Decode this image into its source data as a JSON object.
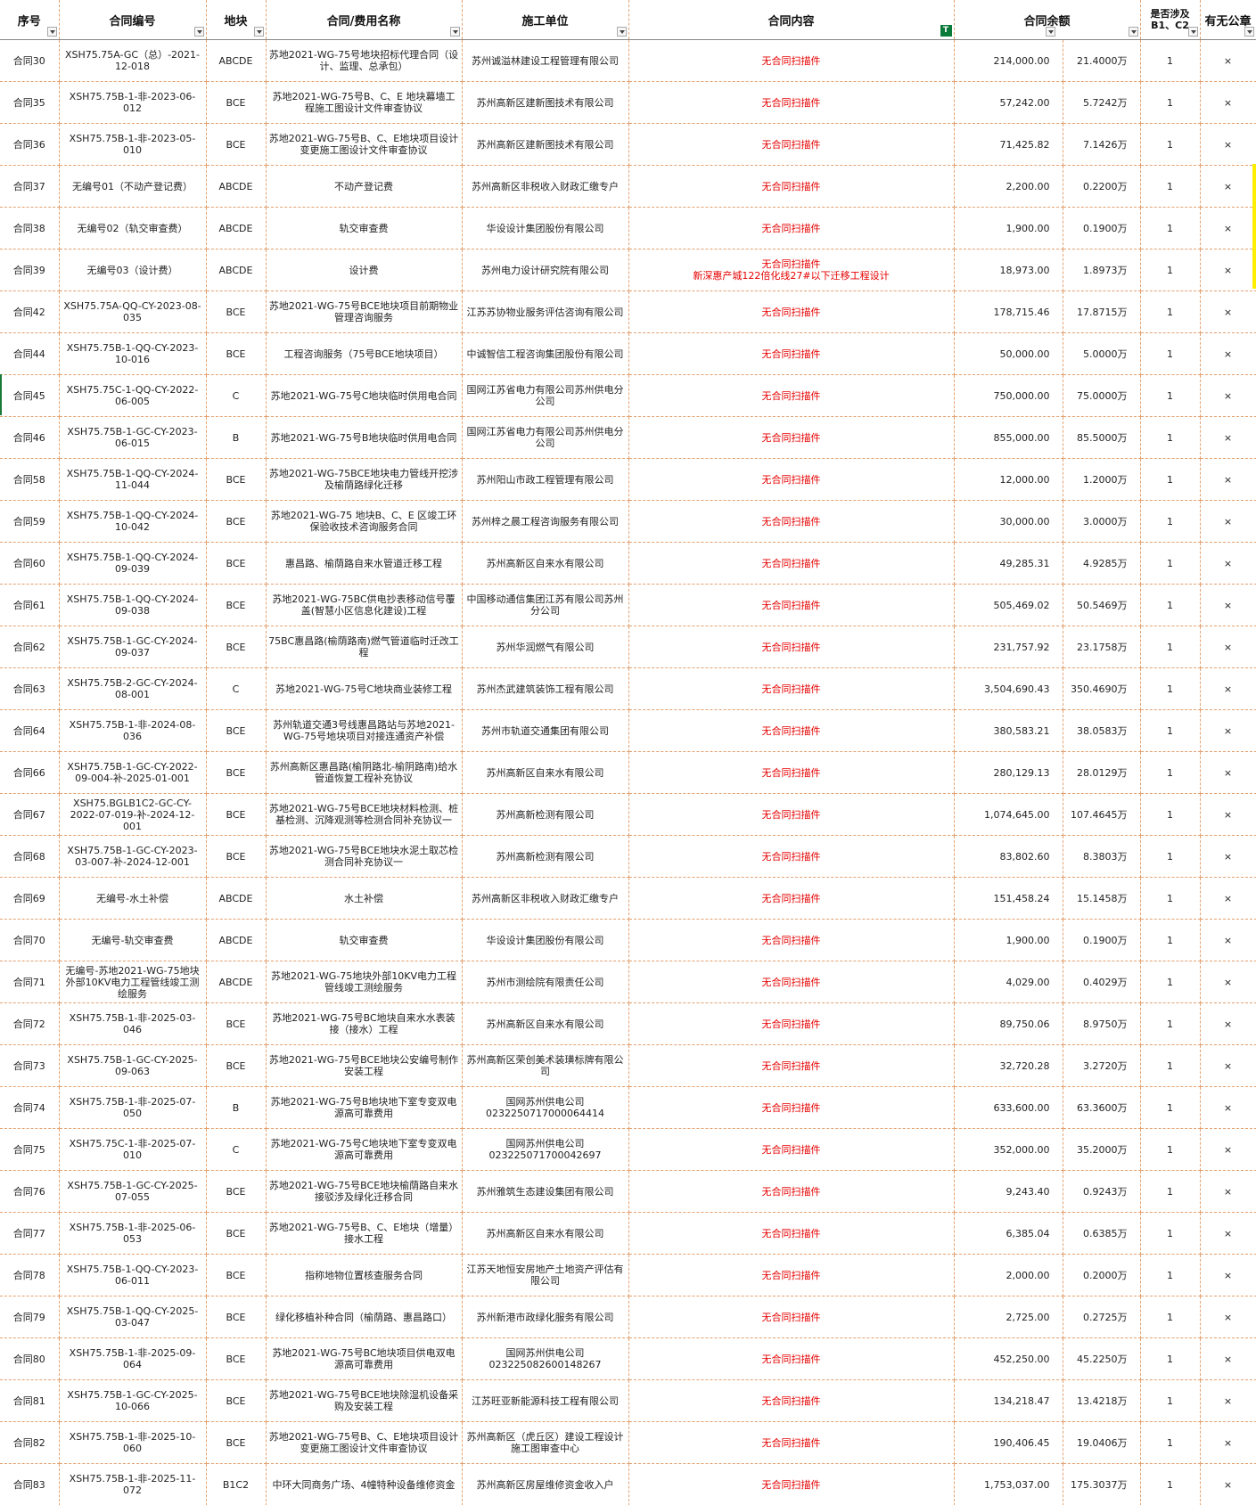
{
  "headers": {
    "seq": "序号",
    "code": "合同编号",
    "plot": "地块",
    "name": "合同/费用名称",
    "unit": "施工单位",
    "content": "合同内容",
    "amount": "合同余额",
    "involve_1": "是否涉及",
    "involve_2": "B1、C2",
    "stamp": "有无公章"
  },
  "icons": {
    "dropdown": "chevron-down-icon",
    "filter_active": "filter-icon"
  },
  "colors": {
    "red_text": "#e60000",
    "grid_border": "#e3a170",
    "filter_green": "#0a7a3a",
    "highlight_yellow": "#ffee00"
  },
  "rows": [
    {
      "seq": "合同30",
      "code": "XSH75.75A-GC（总）-2021-12-018",
      "plot": "ABCDE",
      "name": "苏地2021-WG-75号地块招标代理合同（设计、监理、总承包）",
      "unit": "苏州诚溢林建设工程管理有限公司",
      "content": "无合同扫描件",
      "content2": "",
      "amount": "214,000.00",
      "wan": "21.4000万",
      "involve": "1",
      "stamp": "×"
    },
    {
      "seq": "合同35",
      "code": "XSH75.75B-1-非-2023-06-012",
      "plot": "BCE",
      "name": "苏地2021-WG-75号B、C、E 地块幕墙工程施工图设计文件审查协议",
      "unit": "苏州高新区建新图技术有限公司",
      "content": "无合同扫描件",
      "content2": "",
      "amount": "57,242.00",
      "wan": "5.7242万",
      "involve": "1",
      "stamp": "×"
    },
    {
      "seq": "合同36",
      "code": "XSH75.75B-1-非-2023-05-010",
      "plot": "BCE",
      "name": "苏地2021-WG-75号B、C、E地块项目设计变更施工图设计文件审查协议",
      "unit": "苏州高新区建新图技术有限公司",
      "content": "无合同扫描件",
      "content2": "",
      "amount": "71,425.82",
      "wan": "7.1426万",
      "involve": "1",
      "stamp": "×"
    },
    {
      "seq": "合同37",
      "code": "无编号01（不动产登记费）",
      "plot": "ABCDE",
      "name": "不动产登记费",
      "unit": "苏州高新区非税收入财政汇缴专户",
      "content": "无合同扫描件",
      "content2": "",
      "amount": "2,200.00",
      "wan": "0.2200万",
      "involve": "1",
      "stamp": "×"
    },
    {
      "seq": "合同38",
      "code": "无编号02（轨交审查费）",
      "plot": "ABCDE",
      "name": "轨交审查费",
      "unit": "华设设计集团股份有限公司",
      "content": "无合同扫描件",
      "content2": "",
      "amount": "1,900.00",
      "wan": "0.1900万",
      "involve": "1",
      "stamp": "×"
    },
    {
      "seq": "合同39",
      "code": "无编号03（设计费）",
      "plot": "ABCDE",
      "name": "设计费",
      "unit": "苏州电力设计研究院有限公司",
      "content": "无合同扫描件",
      "content2": "新深惠产城122倍化线27#以下迁移工程设计",
      "amount": "18,973.00",
      "wan": "1.8973万",
      "involve": "1",
      "stamp": "×"
    },
    {
      "seq": "合同42",
      "code": "XSH75.75A-QQ-CY-2023-08-035",
      "plot": "BCE",
      "name": "苏地2021-WG-75号BCE地块项目前期物业管理咨询服务",
      "unit": "江苏苏协物业服务评估咨询有限公司",
      "content": "无合同扫描件",
      "content2": "",
      "amount": "178,715.46",
      "wan": "17.8715万",
      "involve": "1",
      "stamp": "×"
    },
    {
      "seq": "合同44",
      "code": "XSH75.75B-1-QQ-CY-2023-10-016",
      "plot": "BCE",
      "name": "工程咨询服务（75号BCE地块项目）",
      "unit": "中诚智信工程咨询集团股份有限公司",
      "content": "无合同扫描件",
      "content2": "",
      "amount": "50,000.00",
      "wan": "5.0000万",
      "involve": "1",
      "stamp": "×"
    },
    {
      "seq": "合同45",
      "code": "XSH75.75C-1-QQ-CY-2022-06-005",
      "plot": "C",
      "name": "苏地2021-WG-75号C地块临时供用电合同",
      "unit": "国网江苏省电力有限公司苏州供电分公司",
      "content": "无合同扫描件",
      "content2": "",
      "amount": "750,000.00",
      "wan": "75.0000万",
      "involve": "1",
      "stamp": "×"
    },
    {
      "seq": "合同46",
      "code": "XSH75.75B-1-GC-CY-2023-06-015",
      "plot": "B",
      "name": "苏地2021-WG-75号B地块临时供用电合同",
      "unit": "国网江苏省电力有限公司苏州供电分公司",
      "content": "无合同扫描件",
      "content2": "",
      "amount": "855,000.00",
      "wan": "85.5000万",
      "involve": "1",
      "stamp": "×"
    },
    {
      "seq": "合同58",
      "code": "XSH75.75B-1-QQ-CY-2024-11-044",
      "plot": "BCE",
      "name": "苏地2021-WG-75BCE地块电力管线开挖涉及榆荫路绿化迁移",
      "unit": "苏州阳山市政工程管理有限公司",
      "content": "无合同扫描件",
      "content2": "",
      "amount": "12,000.00",
      "wan": "1.2000万",
      "involve": "1",
      "stamp": "×"
    },
    {
      "seq": "合同59",
      "code": "XSH75.75B-1-QQ-CY-2024-10-042",
      "plot": "BCE",
      "name": "苏地2021-WG-75 地块B、C、E 区竣工环保验收技术咨询服务合同",
      "unit": "苏州梓之晨工程咨询服务有限公司",
      "content": "无合同扫描件",
      "content2": "",
      "amount": "30,000.00",
      "wan": "3.0000万",
      "involve": "1",
      "stamp": "×"
    },
    {
      "seq": "合同60",
      "code": "XSH75.75B-1-QQ-CY-2024-09-039",
      "plot": "BCE",
      "name": "惠昌路、榆荫路自来水管道迁移工程",
      "unit": "苏州高新区自来水有限公司",
      "content": "无合同扫描件",
      "content2": "",
      "amount": "49,285.31",
      "wan": "4.9285万",
      "involve": "1",
      "stamp": "×"
    },
    {
      "seq": "合同61",
      "code": "XSH75.75B-1-QQ-CY-2024-09-038",
      "plot": "BCE",
      "name": "苏地2021-WG-75BC供电抄表移动信号覆盖(智慧小区信息化建设)工程",
      "unit": "中国移动通信集团江苏有限公司苏州分公司",
      "content": "无合同扫描件",
      "content2": "",
      "amount": "505,469.02",
      "wan": "50.5469万",
      "involve": "1",
      "stamp": "×"
    },
    {
      "seq": "合同62",
      "code": "XSH75.75B-1-GC-CY-2024-09-037",
      "plot": "BCE",
      "name": "75BC惠昌路(榆荫路南)燃气管道临时迁改工程",
      "unit": "苏州华润燃气有限公司",
      "content": "无合同扫描件",
      "content2": "",
      "amount": "231,757.92",
      "wan": "23.1758万",
      "involve": "1",
      "stamp": "×"
    },
    {
      "seq": "合同63",
      "code": "XSH75.75B-2-GC-CY-2024-08-001",
      "plot": "C",
      "name": "苏地2021-WG-75号C地块商业装修工程",
      "unit": "苏州杰武建筑装饰工程有限公司",
      "content": "无合同扫描件",
      "content2": "",
      "amount": "3,504,690.43",
      "wan": "350.4690万",
      "involve": "1",
      "stamp": "×"
    },
    {
      "seq": "合同64",
      "code": "XSH75.75B-1-非-2024-08-036",
      "plot": "BCE",
      "name": "苏州轨道交通3号线惠昌路站与苏地2021-WG-75号地块项目对接连通资产补偿",
      "unit": "苏州市轨道交通集团有限公司",
      "content": "无合同扫描件",
      "content2": "",
      "amount": "380,583.21",
      "wan": "38.0583万",
      "involve": "1",
      "stamp": "×"
    },
    {
      "seq": "合同66",
      "code": "XSH75.75B-1-GC-CY-2022-09-004-补-2025-01-001",
      "plot": "BCE",
      "name": "苏州高新区惠昌路(榆阴路北-榆阴路南)给水管道恢复工程补充协议",
      "unit": "苏州高新区自来水有限公司",
      "content": "无合同扫描件",
      "content2": "",
      "amount": "280,129.13",
      "wan": "28.0129万",
      "involve": "1",
      "stamp": "×"
    },
    {
      "seq": "合同67",
      "code": "XSH75.BGLB1C2-GC-CY-2022-07-019-补-2024-12-001",
      "plot": "BCE",
      "name": "苏地2021-WG-75号BCE地块材料检测、桩基检测、沉降观测等检测合同补充协议一",
      "unit": "苏州高新检测有限公司",
      "content": "无合同扫描件",
      "content2": "",
      "amount": "1,074,645.00",
      "wan": "107.4645万",
      "involve": "1",
      "stamp": "×"
    },
    {
      "seq": "合同68",
      "code": "XSH75.75B-1-GC-CY-2023-03-007-补-2024-12-001",
      "plot": "BCE",
      "name": "苏地2021-WG-75号BCE地块水泥土取芯检测合同补充协议一",
      "unit": "苏州高新检测有限公司",
      "content": "无合同扫描件",
      "content2": "",
      "amount": "83,802.60",
      "wan": "8.3803万",
      "involve": "1",
      "stamp": "×"
    },
    {
      "seq": "合同69",
      "code": "无编号-水土补偿",
      "plot": "ABCDE",
      "name": "水土补偿",
      "unit": "苏州高新区非税收入财政汇缴专户",
      "content": "无合同扫描件",
      "content2": "",
      "amount": "151,458.24",
      "wan": "15.1458万",
      "involve": "1",
      "stamp": "×"
    },
    {
      "seq": "合同70",
      "code": "无编号-轨交审查费",
      "plot": "ABCDE",
      "name": "轨交审查费",
      "unit": "华设设计集团股份有限公司",
      "content": "无合同扫描件",
      "content2": "",
      "amount": "1,900.00",
      "wan": "0.1900万",
      "involve": "1",
      "stamp": "×"
    },
    {
      "seq": "合同71",
      "code": "无编号-苏地2021-WG-75地块外部10KV电力工程管线竣工测绘服务",
      "plot": "ABCDE",
      "name": "苏地2021-WG-75地块外部10KV电力工程管线竣工测绘服务",
      "unit": "苏州市测绘院有限责任公司",
      "content": "无合同扫描件",
      "content2": "",
      "amount": "4,029.00",
      "wan": "0.4029万",
      "involve": "1",
      "stamp": "×"
    },
    {
      "seq": "合同72",
      "code": "XSH75.75B-1-非-2025-03-046",
      "plot": "BCE",
      "name": "苏地2021-WG-75号BC地块自来水水表装接（接水）工程",
      "unit": "苏州高新区自来水有限公司",
      "content": "无合同扫描件",
      "content2": "",
      "amount": "89,750.06",
      "wan": "8.9750万",
      "involve": "1",
      "stamp": "×"
    },
    {
      "seq": "合同73",
      "code": "XSH75.75B-1-GC-CY-2025-09-063",
      "plot": "BCE",
      "name": "苏地2021-WG-75号BCE地块公安编号制作安装工程",
      "unit": "苏州高新区荣创美术装璜标牌有限公司",
      "content": "无合同扫描件",
      "content2": "",
      "amount": "32,720.28",
      "wan": "3.2720万",
      "involve": "1",
      "stamp": "×"
    },
    {
      "seq": "合同74",
      "code": "XSH75.75B-1-非-2025-07-050",
      "plot": "B",
      "name": "苏地2021-WG-75号B地块地下室专变双电源高可靠费用",
      "unit": "国网苏州供电公司 0232250717000064414",
      "content": "无合同扫描件",
      "content2": "",
      "amount": "633,600.00",
      "wan": "63.3600万",
      "involve": "1",
      "stamp": "×"
    },
    {
      "seq": "合同75",
      "code": "XSH75.75C-1-非-2025-07-010",
      "plot": "C",
      "name": "苏地2021-WG-75号C地块地下室专变双电源高可靠费用",
      "unit": "国网苏州供电公司 023225071700042697",
      "content": "无合同扫描件",
      "content2": "",
      "amount": "352,000.00",
      "wan": "35.2000万",
      "involve": "1",
      "stamp": "×"
    },
    {
      "seq": "合同76",
      "code": "XSH75.75B-1-GC-CY-2025-07-055",
      "plot": "BCE",
      "name": "苏地2021-WG-75号BCE地块榆荫路自来水接驳涉及绿化迁移合同",
      "unit": "苏州雅筑生态建设集团有限公司",
      "content": "无合同扫描件",
      "content2": "",
      "amount": "9,243.40",
      "wan": "0.9243万",
      "involve": "1",
      "stamp": "×"
    },
    {
      "seq": "合同77",
      "code": "XSH75.75B-1-非-2025-06-053",
      "plot": "BCE",
      "name": "苏地2021-WG-75号B、C、E地块（增量）接水工程",
      "unit": "苏州高新区自来水有限公司",
      "content": "无合同扫描件",
      "content2": "",
      "amount": "6,385.04",
      "wan": "0.6385万",
      "involve": "1",
      "stamp": "×"
    },
    {
      "seq": "合同78",
      "code": "XSH75.75B-1-QQ-CY-2023-06-011",
      "plot": "BCE",
      "name": "指称地物位置核查服务合同",
      "unit": "江苏天地恒安房地产土地资产评估有限公司",
      "content": "无合同扫描件",
      "content2": "",
      "amount": "2,000.00",
      "wan": "0.2000万",
      "involve": "1",
      "stamp": "×"
    },
    {
      "seq": "合同79",
      "code": "XSH75.75B-1-QQ-CY-2025-03-047",
      "plot": "BCE",
      "name": "绿化移植补种合同（榆荫路、惠昌路口）",
      "unit": "苏州新港市政绿化服务有限公司",
      "content": "无合同扫描件",
      "content2": "",
      "amount": "2,725.00",
      "wan": "0.2725万",
      "involve": "1",
      "stamp": "×"
    },
    {
      "seq": "合同80",
      "code": "XSH75.75B-1-非-2025-09-064",
      "plot": "BCE",
      "name": "苏地2021-WG-75号BC地块项目供电双电源高可靠费用",
      "unit": "国网苏州供电公司 023225082600148267",
      "content": "无合同扫描件",
      "content2": "",
      "amount": "452,250.00",
      "wan": "45.2250万",
      "involve": "1",
      "stamp": "×"
    },
    {
      "seq": "合同81",
      "code": "XSH75.75B-1-GC-CY-2025-10-066",
      "plot": "BCE",
      "name": "苏地2021-WG-75号BCE地块除湿机设备采购及安装工程",
      "unit": "江苏旺亚新能源科技工程有限公司",
      "content": "无合同扫描件",
      "content2": "",
      "amount": "134,218.47",
      "wan": "13.4218万",
      "involve": "1",
      "stamp": "×"
    },
    {
      "seq": "合同82",
      "code": "XSH75.75B-1-非-2025-10-060",
      "plot": "BCE",
      "name": "苏地2021-WG-75号B、C、E地块项目设计变更施工图设计文件审查协议",
      "unit": "苏州高新区（虎丘区）建设工程设计施工图审查中心",
      "content": "无合同扫描件",
      "content2": "",
      "amount": "190,406.45",
      "wan": "19.0406万",
      "involve": "1",
      "stamp": "×"
    },
    {
      "seq": "合同83",
      "code": "XSH75.75B-1-非-2025-11-072",
      "plot": "B1C2",
      "name": "中环大同商务广场、4幢特种设备维修资金",
      "unit": "苏州高新区房屋维修资金收入户",
      "content": "无合同扫描件",
      "content2": "",
      "amount": "1,753,037.00",
      "wan": "175.3037万",
      "involve": "1",
      "stamp": "×"
    }
  ]
}
